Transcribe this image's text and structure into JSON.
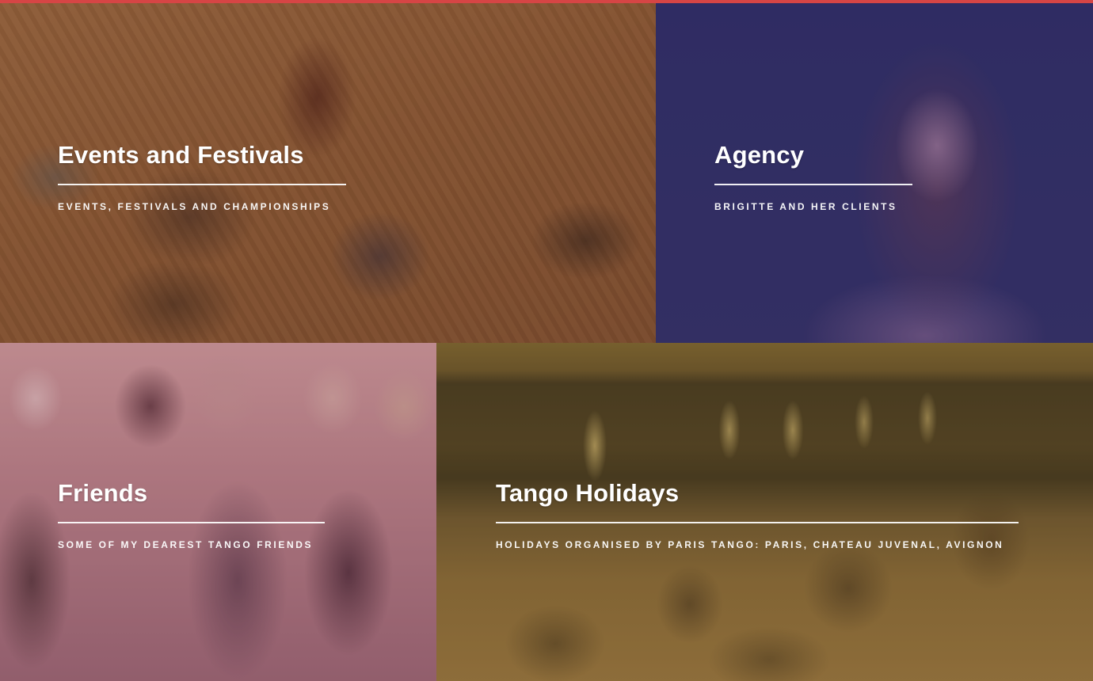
{
  "colors": {
    "accent_bar": "#d64545",
    "text": "#ffffff"
  },
  "tiles": [
    {
      "title": "Events and Festivals",
      "subtitle": "EVENTS, FESTIVALS AND CHAMPIONSHIPS"
    },
    {
      "title": "Agency",
      "subtitle": "BRIGITTE AND HER CLIENTS"
    },
    {
      "title": "Friends",
      "subtitle": "SOME OF MY DEAREST TANGO FRIENDS"
    },
    {
      "title": "Tango Holidays",
      "subtitle": "HOLIDAYS ORGANISED BY PARIS TANGO: PARIS, CHATEAU JUVENAL, AVIGNON"
    }
  ]
}
